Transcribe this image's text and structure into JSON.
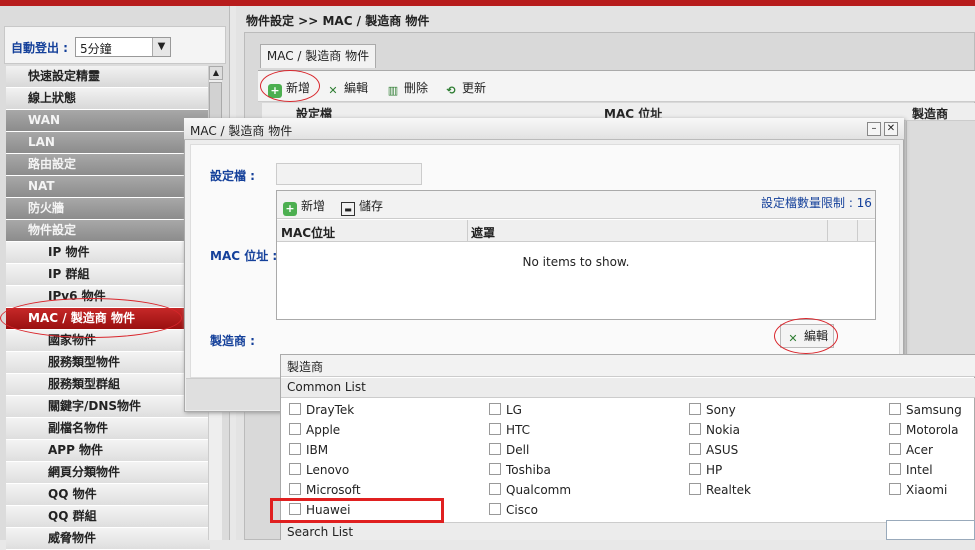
{
  "breadcrumb": "物件設定 >> MAC / 製造商 物件",
  "autologout": {
    "label": "自動登出 :",
    "value": "5分鐘"
  },
  "menu": [
    {
      "label": "快速設定精靈",
      "style": "light"
    },
    {
      "label": "線上狀態",
      "style": "light"
    },
    {
      "label": "WAN",
      "style": "dark"
    },
    {
      "label": "LAN",
      "style": "dark"
    },
    {
      "label": "路由設定",
      "style": "dark"
    },
    {
      "label": "NAT",
      "style": "dark"
    },
    {
      "label": "防火牆",
      "style": "dark"
    },
    {
      "label": "物件設定",
      "style": "dark"
    },
    {
      "label": "IP 物件",
      "style": "sub"
    },
    {
      "label": "IP 群組",
      "style": "sub"
    },
    {
      "label": "IPv6 物件",
      "style": "sub"
    },
    {
      "label": "MAC / 製造商 物件",
      "style": "active"
    },
    {
      "label": "國家物件",
      "style": "sub"
    },
    {
      "label": "服務類型物件",
      "style": "sub"
    },
    {
      "label": "服務類型群組",
      "style": "sub"
    },
    {
      "label": "關鍵字/DNS物件",
      "style": "sub"
    },
    {
      "label": "副檔名物件",
      "style": "sub"
    },
    {
      "label": "APP 物件",
      "style": "sub"
    },
    {
      "label": "網頁分類物件",
      "style": "sub"
    },
    {
      "label": "QQ 物件",
      "style": "sub"
    },
    {
      "label": "QQ 群組",
      "style": "sub"
    },
    {
      "label": "威脅物件",
      "style": "sub"
    }
  ],
  "tab": "MAC / 製造商 物件",
  "toolbar": {
    "add": "新增",
    "edit": "編輯",
    "delete": "刪除",
    "refresh": "更新"
  },
  "table_headers": {
    "profile": "設定檔",
    "mac": "MAC 位址",
    "vendor": "製造商"
  },
  "dialog": {
    "title": "MAC / 製造商 物件",
    "profile_label": "設定檔 :",
    "mac_label": "MAC 位址 :",
    "vendor_label": "製造商 :",
    "grid_add": "新增",
    "grid_save": "儲存",
    "limit_text": "設定檔數量限制 :  16",
    "col_mac": "MAC位址",
    "col_mask": "遮罩",
    "empty_text": "No items to show.",
    "edit_button": "編輯"
  },
  "vendor_popup": {
    "title": "製造商",
    "common_list_label": "Common List",
    "search_list_label": "Search List",
    "columns": [
      [
        "DrayTek",
        "Apple",
        "IBM",
        "Lenovo",
        "Microsoft",
        "Huawei"
      ],
      [
        "LG",
        "HTC",
        "Dell",
        "Toshiba",
        "Qualcomm",
        "Cisco"
      ],
      [
        "Sony",
        "Nokia",
        "ASUS",
        "HP",
        "Realtek"
      ],
      [
        "Samsung",
        "Motorola",
        "Acer",
        "Intel",
        "Xiaomi"
      ]
    ]
  },
  "colors": {
    "accent_red": "#c62828",
    "label_blue": "#14409a",
    "highlight_red": "#e02020"
  }
}
